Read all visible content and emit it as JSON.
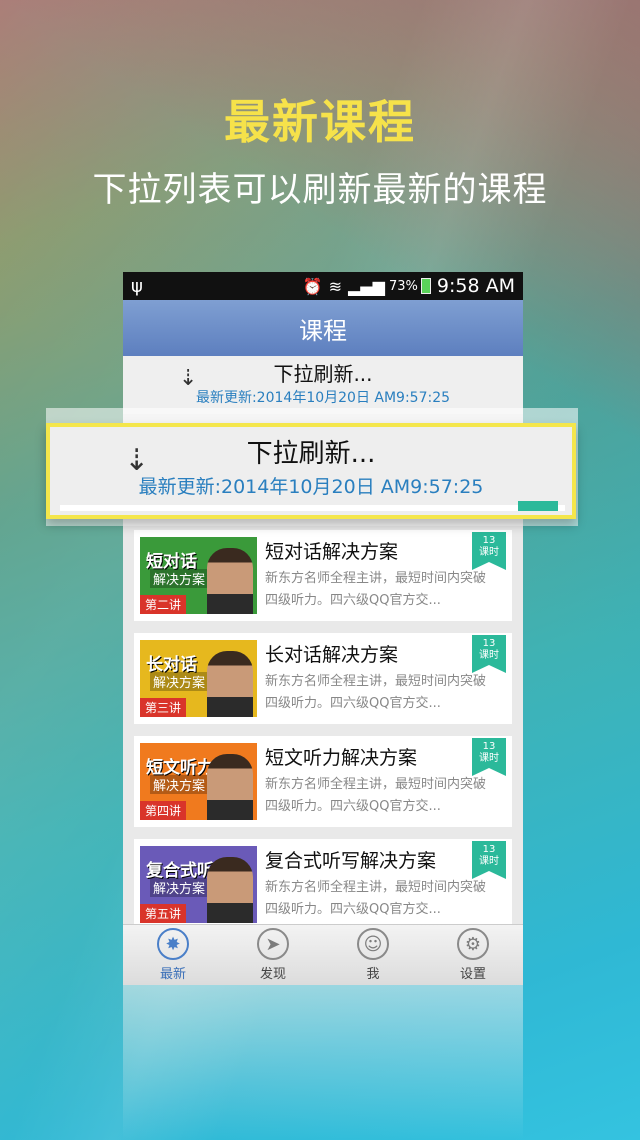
{
  "promo": {
    "headline": "最新课程",
    "subline": "下拉列表可以刷新最新的课程"
  },
  "statusbar": {
    "usb_icon": "usb-icon",
    "battery": "73%",
    "time": "9:58 AM"
  },
  "app": {
    "title": "课程",
    "refresh_text": "下拉刷新...",
    "last_update": "最新更新:2014年10月20日 AM9:57:25"
  },
  "courses": [
    {
      "title": "短对话解决方案",
      "desc": "新东方名师全程主讲，最短时间内突破四级听力。四六级QQ官方交...",
      "badge_num": "13",
      "badge_unit": "课时",
      "thumb_tag": "短对话",
      "thumb_sub": "解决方案",
      "lecture": "第二讲",
      "thumb_color": "#3a9a3a"
    },
    {
      "title": "长对话解决方案",
      "desc": "新东方名师全程主讲，最短时间内突破四级听力。四六级QQ官方交...",
      "badge_num": "13",
      "badge_unit": "课时",
      "thumb_tag": "长对话",
      "thumb_sub": "解决方案",
      "lecture": "第三讲",
      "thumb_color": "#e6b81e"
    },
    {
      "title": "短文听力解决方案",
      "desc": "新东方名师全程主讲，最短时间内突破四级听力。四六级QQ官方交...",
      "badge_num": "13",
      "badge_unit": "课时",
      "thumb_tag": "短文听力",
      "thumb_sub": "解决方案",
      "lecture": "第四讲",
      "thumb_color": "#f07a1e"
    },
    {
      "title": "复合式听写解决方案",
      "desc": "新东方名师全程主讲，最短时间内突破四级听力。四六级QQ官方交...",
      "badge_num": "13",
      "badge_unit": "课时",
      "thumb_tag": "复合式听写",
      "thumb_sub": "解决方案",
      "lecture": "第五讲",
      "thumb_color": "#6a5ab8"
    }
  ],
  "tabs": [
    {
      "label": "最新",
      "icon": "news-icon"
    },
    {
      "label": "发现",
      "icon": "compass-icon"
    },
    {
      "label": "我",
      "icon": "person-icon"
    },
    {
      "label": "设置",
      "icon": "gear-icon"
    }
  ]
}
